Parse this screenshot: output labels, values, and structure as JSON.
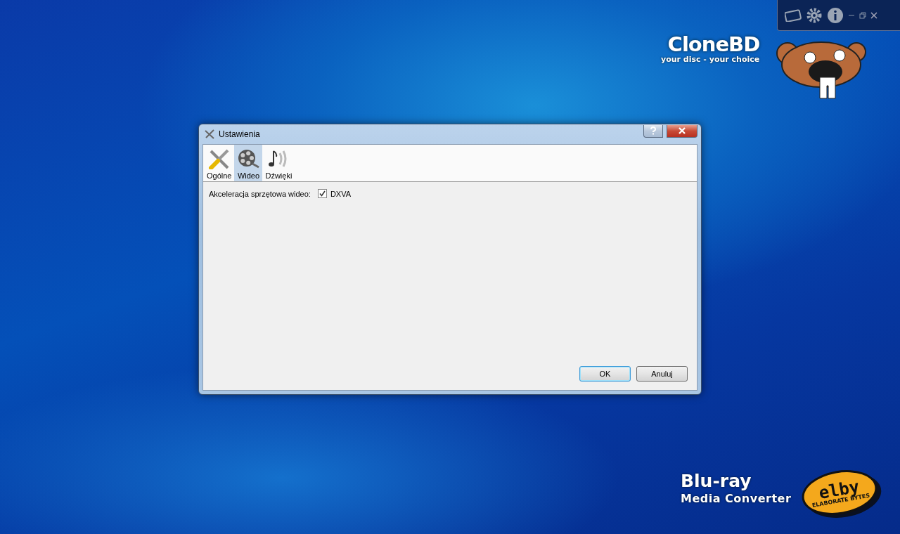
{
  "brand": {
    "name": "CloneBD",
    "tagline": "your disc - your choice"
  },
  "dialog": {
    "title": "Ustawienia",
    "tabs": [
      {
        "label": "Ogólne",
        "selected": false,
        "kind": "tools"
      },
      {
        "label": "Wideo",
        "selected": true,
        "kind": "film"
      },
      {
        "label": "Dźwięki",
        "selected": false,
        "kind": "sound"
      }
    ],
    "settings": [
      {
        "label": "Akceleracja sprzętowa wideo:",
        "option": "DXVA",
        "checked": true
      }
    ],
    "buttons": [
      {
        "label": "OK",
        "default": true
      },
      {
        "label": "Anuluj",
        "default": false
      }
    ]
  },
  "product": {
    "line1": "Blu-ray",
    "line2": "Media Converter"
  },
  "vendor_logo": {
    "name": "elby",
    "tagline": "ELABORATE BYTES"
  }
}
